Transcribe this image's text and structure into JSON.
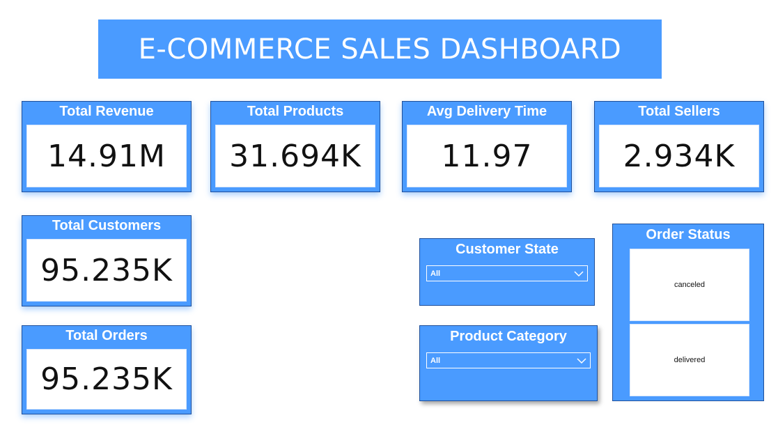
{
  "header": {
    "title": "E-COMMERCE SALES DASHBOARD"
  },
  "cards": {
    "total_revenue": {
      "label": "Total Revenue",
      "value": "14.91M"
    },
    "total_products": {
      "label": "Total Products",
      "value": "31.694K"
    },
    "avg_delivery_time": {
      "label": "Avg Delivery Time",
      "value": "11.97"
    },
    "total_sellers": {
      "label": "Total Sellers",
      "value": "2.934K"
    },
    "total_customers": {
      "label": "Total Customers",
      "value": "95.235K"
    },
    "total_orders": {
      "label": "Total Orders",
      "value": "95.235K"
    }
  },
  "filters": {
    "customer_state": {
      "label": "Customer State",
      "selected": "All"
    },
    "product_category": {
      "label": "Product Category",
      "selected": "All"
    }
  },
  "order_status": {
    "label": "Order Status",
    "items": [
      "canceled",
      "delivered"
    ]
  },
  "colors": {
    "accent": "#4a9bff",
    "border": "#1f4f99",
    "tile": "#ffffff"
  },
  "icons": {
    "dropdown": "chevron-down-icon"
  }
}
